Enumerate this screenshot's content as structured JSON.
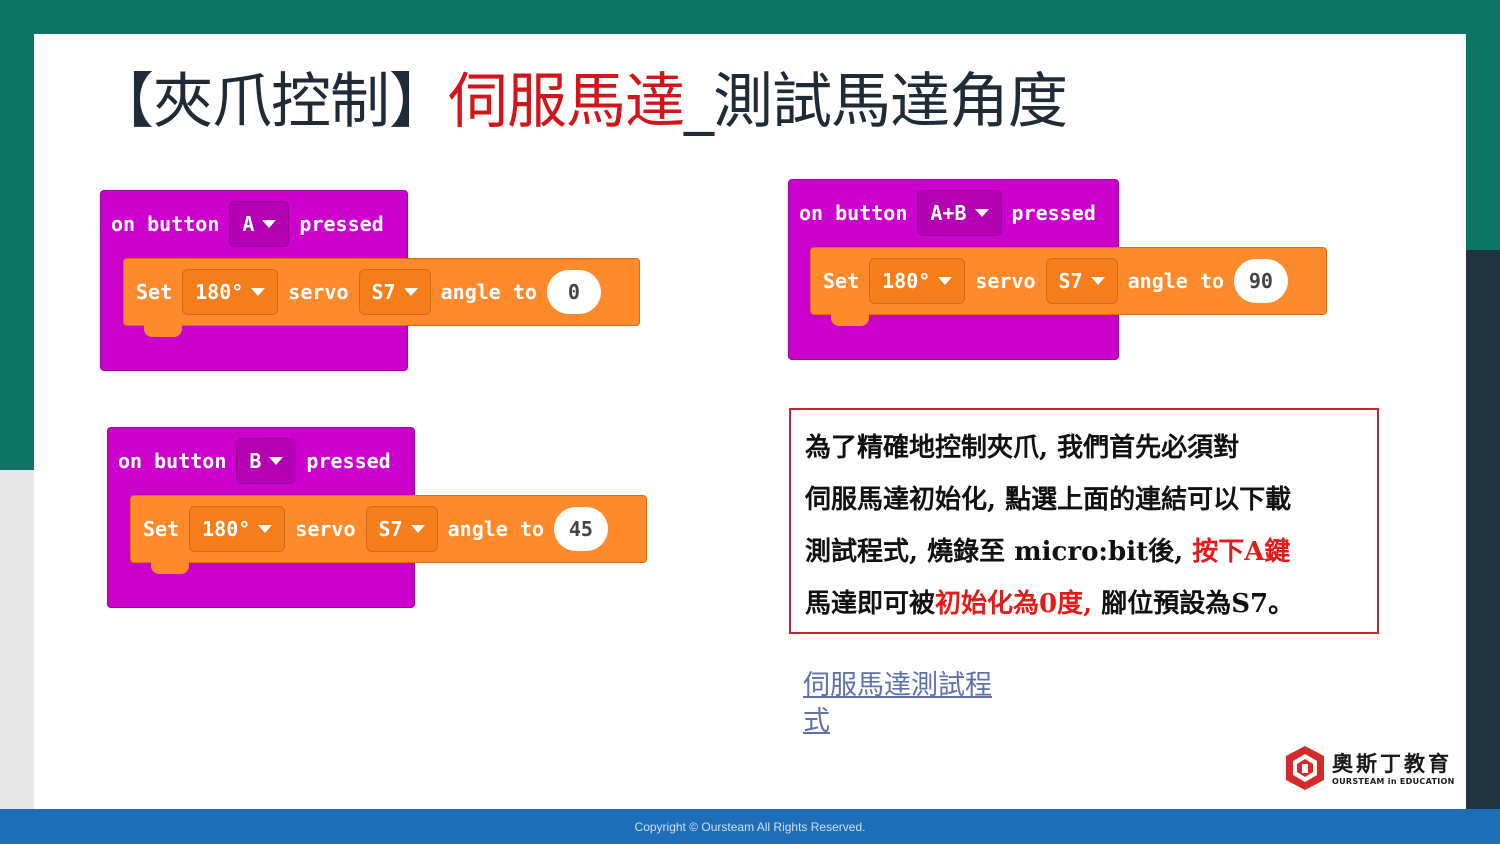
{
  "title": {
    "part1": "【夾爪控制】",
    "part2": "伺服馬達",
    "part3": "_測試馬達角度"
  },
  "blocks": [
    {
      "event": "on button",
      "button": "A",
      "pressed": "pressed",
      "set": "Set",
      "servo_type": "180°",
      "servo": "servo",
      "pin": "S7",
      "angle_to": "angle to",
      "value": "0"
    },
    {
      "event": "on button",
      "button": "A+B",
      "pressed": "pressed",
      "set": "Set",
      "servo_type": "180°",
      "servo": "servo",
      "pin": "S7",
      "angle_to": "angle to",
      "value": "90"
    },
    {
      "event": "on button",
      "button": "B",
      "pressed": "pressed",
      "set": "Set",
      "servo_type": "180°",
      "servo": "servo",
      "pin": "S7",
      "angle_to": "angle to",
      "value": "45"
    }
  ],
  "note": {
    "line1": "為了精確地控制夾爪, 我們首先必須對",
    "line2": "伺服馬達初始化, 點選上面的連結可以下載",
    "line3a": "測試程式, 燒錄至 micro:bit後, ",
    "line3b": "按下A鍵",
    "line4a": "馬達即可被",
    "line4b": "初始化為0度,",
    "line4c": " 腳位預設為S7。"
  },
  "link": {
    "text": "伺服馬達測試程式"
  },
  "logo": {
    "cn": "奧斯丁教育",
    "en": "OURSTEAM in EDUCATION"
  },
  "footer": {
    "copyright": "Copyright © Oursteam All Rights Reserved."
  },
  "colors": {
    "event_block": "#cc00cc",
    "servo_block": "#ff8a2b",
    "title_red": "#d0161b",
    "footer": "#1e6db7",
    "frame": "#0f7466"
  }
}
